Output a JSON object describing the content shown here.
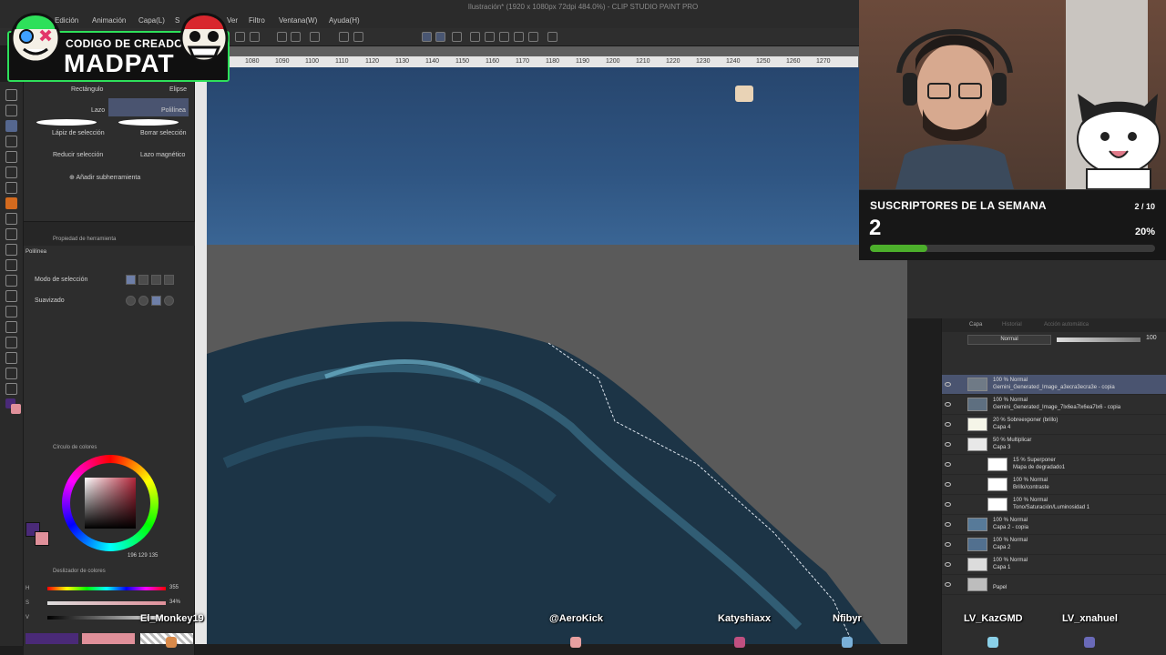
{
  "title_bar": {
    "text": "Ilustración* (1920 x 1080px 72dpi 484.0%) - CLIP STUDIO PAINT PRO"
  },
  "menu": {
    "items": [
      "Edición",
      "Animación",
      "Capa(L)",
      "S",
      "Ver",
      "Filtro",
      "Ventana(W)",
      "Ayuda(H)"
    ]
  },
  "logo": {
    "line1": "CODIGO DE CREADOR",
    "line2": "MADPAT"
  },
  "subtool": {
    "items": [
      "Rectángulo",
      "Elipse",
      "Lazo",
      "Polilínea",
      "Lápiz de selección",
      "Borrar selección",
      "Reducir selección",
      "Lazo magnético"
    ],
    "selected": "Polilínea",
    "add_label": "Añadir subherramienta"
  },
  "tool_property": {
    "header": "Propiedad de herramienta",
    "tool_name": "Polilínea",
    "selection_mode_label": "Modo de selección",
    "smoothing_label": "Suavizado"
  },
  "color_circle": {
    "header": "Círculo de colores",
    "h": "196",
    "s": "129",
    "v": "135"
  },
  "color_slider": {
    "header": "Deslizador de colores",
    "rows": [
      {
        "label": "H",
        "value": "355"
      },
      {
        "label": "S",
        "value": "34%"
      },
      {
        "label": "V",
        "value": ""
      }
    ]
  },
  "ruler": {
    "marks": [
      "1020",
      "1080",
      "1090",
      "1100",
      "1110",
      "1120",
      "1130",
      "1140",
      "1150",
      "1160",
      "1170",
      "1180",
      "1190",
      "1200",
      "1210",
      "1220",
      "1230",
      "1240",
      "1250",
      "1260",
      "1270"
    ]
  },
  "subscribers": {
    "title": "SUSCRIPTORES DE LA SEMANA",
    "count": "2",
    "goal": "2 / 10",
    "percent": "20%",
    "fill": 0.2,
    "color": "#4caf2b"
  },
  "layers": {
    "tabs": [
      "Capa",
      "Historial",
      "Acción automática"
    ],
    "blend_mode": "Normal",
    "opacity": "100",
    "items": [
      {
        "line1": "100 % Normal",
        "line2": "Gemini_Generated_Image_a3ecra3ecra3e - copia",
        "selected": true
      },
      {
        "line1": "100 % Normal",
        "line2": "Gemini_Generated_Image_7lx6ea7lx6ea7lx6 - copia",
        "selected": false
      },
      {
        "line1": "20 % Sobreexponer (brillo)",
        "line2": "Capa 4",
        "selected": false
      },
      {
        "line1": "50 % Multiplicar",
        "line2": "Capa 3",
        "selected": false
      },
      {
        "line1": "15 % Superponer",
        "line2": "Mapa de degradado1",
        "selected": false
      },
      {
        "line1": "100 % Normal",
        "line2": "Brillo/contraste",
        "selected": false
      },
      {
        "line1": "100 % Normal",
        "line2": "Tono/Saturación/Luminosidad 1",
        "selected": false
      },
      {
        "line1": "100 % Normal",
        "line2": "Capa 2 - copia",
        "selected": false
      },
      {
        "line1": "100 % Normal",
        "line2": "Capa 2",
        "selected": false
      },
      {
        "line1": "100 % Normal",
        "line2": "Capa 1",
        "selected": false
      },
      {
        "line1": "",
        "line2": "Papel",
        "selected": false
      }
    ]
  },
  "chat": [
    "El_Monkey19",
    "@AeroKick",
    "Katyshiaxx",
    "Nfibyr",
    "LV_KazGMD",
    "LV_xnahuel"
  ],
  "colors": {
    "main": "#4a2a78",
    "sub": "#e0909a",
    "accent": "#2ee05a"
  }
}
